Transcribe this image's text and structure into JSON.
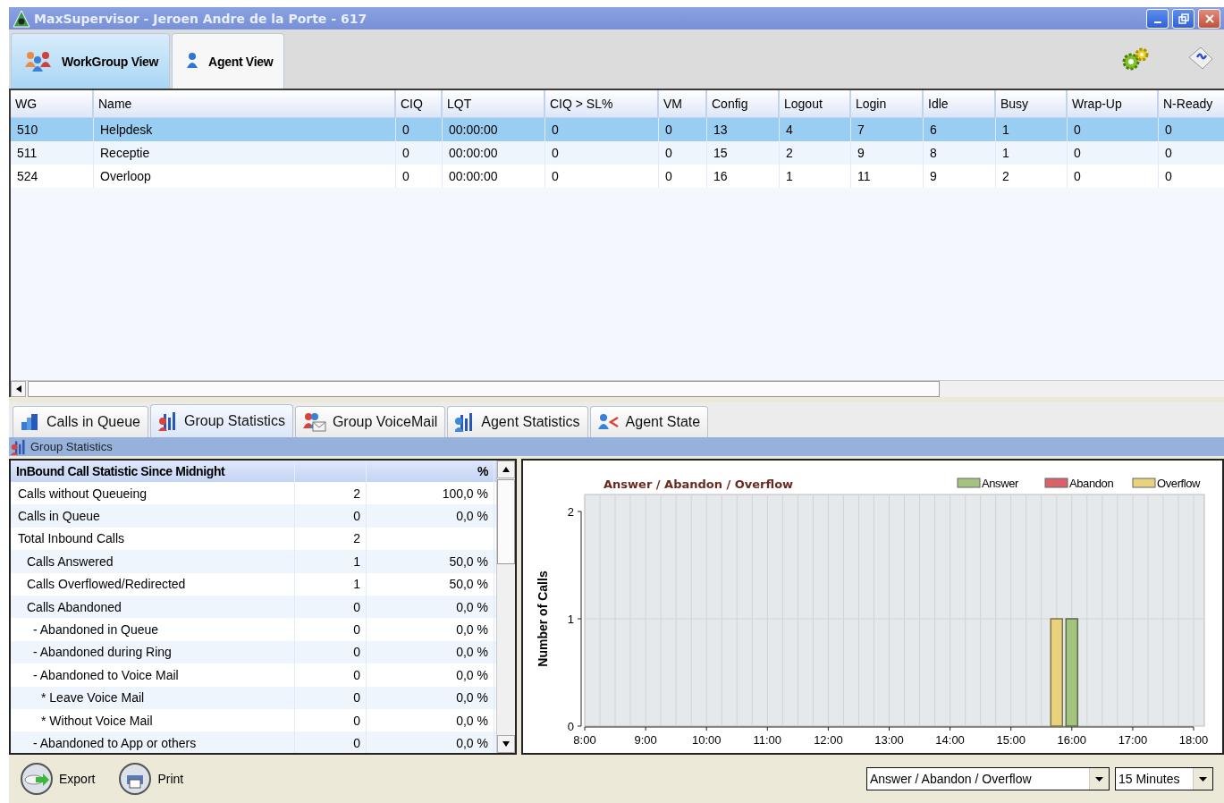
{
  "window": {
    "title": "MaxSupervisor - Jeroen Andre de la Porte - 617"
  },
  "view_tabs": [
    {
      "label": "WorkGroup View",
      "kind": "group",
      "selected": true
    },
    {
      "label": "Agent View",
      "kind": "agent",
      "selected": false
    }
  ],
  "table": {
    "columns": [
      "WG",
      "Name",
      "CIQ",
      "LQT",
      "CIQ > SL%",
      "VM",
      "Config",
      "Logout",
      "Login",
      "Idle",
      "Busy",
      "Wrap-Up",
      "N-Ready"
    ],
    "rows": [
      {
        "cells": [
          "510",
          "Helpdesk",
          "0",
          "00:00:00",
          "0",
          "0",
          "13",
          "4",
          "7",
          "6",
          "1",
          "0",
          "0"
        ],
        "selected": true
      },
      {
        "cells": [
          "511",
          "Receptie",
          "0",
          "00:00:00",
          "0",
          "0",
          "15",
          "2",
          "9",
          "8",
          "1",
          "0",
          "0"
        ],
        "selected": false
      },
      {
        "cells": [
          "524",
          "Overloop",
          "0",
          "00:00:00",
          "0",
          "0",
          "16",
          "1",
          "11",
          "9",
          "2",
          "0",
          "0"
        ],
        "selected": false
      }
    ]
  },
  "bottom_tabs": [
    {
      "label": "Calls in Queue",
      "kind": "queue",
      "selected": false
    },
    {
      "label": "Group Statistics",
      "kind": "groupstats",
      "selected": true
    },
    {
      "label": "Group VoiceMail",
      "kind": "voicemail",
      "selected": false
    },
    {
      "label": "Agent Statistics",
      "kind": "agentstats",
      "selected": false
    },
    {
      "label": "Agent State",
      "kind": "agentstate",
      "selected": false
    }
  ],
  "section_title": "Group Statistics",
  "stats": {
    "header": "InBound Call Statistic Since Midnight",
    "percent_header": "%",
    "rows": [
      {
        "label": "Calls without Queueing",
        "count": "2",
        "percent": "100,0 %"
      },
      {
        "label": "Calls in Queue",
        "count": "0",
        "percent": "0,0 %"
      },
      {
        "label": "Total Inbound Calls",
        "count": "2",
        "children": [
          {
            "label": "Calls Answered",
            "count": "1",
            "percent": "50,0 %"
          },
          {
            "label": "Calls Overflowed/Redirected",
            "count": "1",
            "percent": "50,0 %"
          },
          {
            "label": "Calls Abandoned",
            "count": "0",
            "percent": "0,0 %",
            "children": [
              {
                "label": "- Abandoned in Queue",
                "count": "0",
                "percent": "0,0 %"
              },
              {
                "label": "- Abandoned during Ring",
                "count": "0",
                "percent": "0,0 %"
              },
              {
                "label": "- Abandoned to Voice Mail",
                "count": "0",
                "percent": "0,0 %",
                "children": [
                  {
                    "label": "* Leave Voice Mail",
                    "count": "0",
                    "percent": "0,0 %"
                  },
                  {
                    "label": "* Without Voice Mail",
                    "count": "0",
                    "percent": "0,0 %"
                  }
                ]
              },
              {
                "label": "- Abandoned to App or others",
                "count": "0",
                "percent": "0,0 %"
              }
            ]
          }
        ]
      }
    ]
  },
  "chart": {
    "chart_data": {
      "type": "bar",
      "title": "Answer / Abandon / Overflow",
      "ylabel": "Number of Calls",
      "x": [
        15.75,
        16
      ],
      "series": [
        {
          "name": "Answer",
          "color": "#a3c47f",
          "values": [
            0,
            1
          ]
        },
        {
          "name": "Abandon",
          "color": "#d9616a",
          "values": [
            0,
            0
          ]
        },
        {
          "name": "Overflow",
          "color": "#e8d27e",
          "values": [
            1,
            0
          ]
        }
      ],
      "legend": true,
      "grid": true,
      "xlim": [
        8,
        18
      ],
      "ylim": [
        0,
        2
      ],
      "yticks": [
        {
          "value": 0,
          "label": "0"
        },
        {
          "value": 1,
          "label": "1"
        },
        {
          "value": 2,
          "label": "2"
        }
      ],
      "xticks": [
        {
          "value": 8,
          "label": "8:00"
        },
        {
          "value": 9,
          "label": "9:00"
        },
        {
          "value": 10,
          "label": "10:00"
        },
        {
          "value": 11,
          "label": "11:00"
        },
        {
          "value": 12,
          "label": "12:00"
        },
        {
          "value": 13,
          "label": "13:00"
        },
        {
          "value": 14,
          "label": "14:00"
        },
        {
          "value": 15,
          "label": "15:00"
        },
        {
          "value": 16,
          "label": "16:00"
        },
        {
          "value": 17,
          "label": "17:00"
        },
        {
          "value": 18,
          "label": "18:00"
        }
      ]
    }
  },
  "footer": {
    "buttons": [
      {
        "label": "Export",
        "kind": "export"
      },
      {
        "label": "Print",
        "kind": "print"
      }
    ],
    "chart_select": {
      "value": "Answer / Abandon / Overflow"
    },
    "interval_select": {
      "value": "15 Minutes"
    }
  }
}
